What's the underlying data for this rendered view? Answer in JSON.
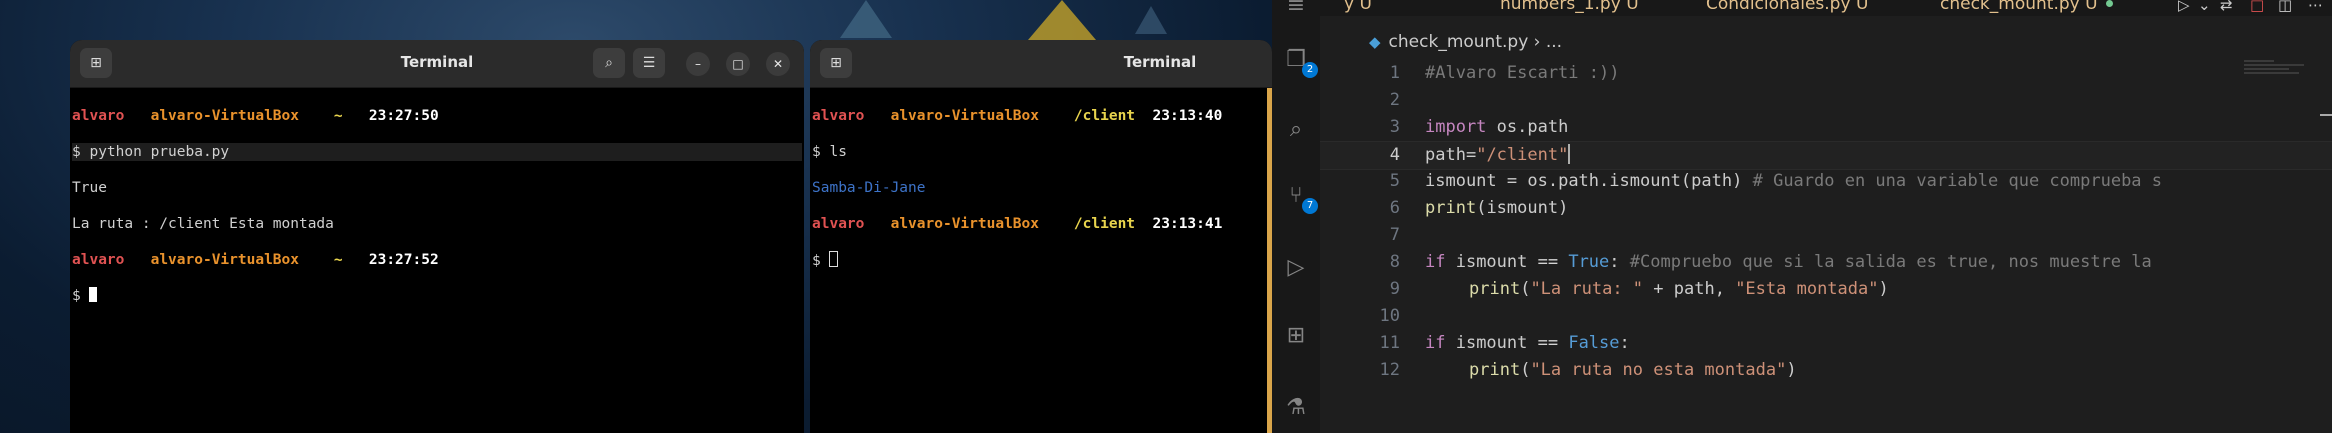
{
  "terminal_left": {
    "title": "Terminal",
    "lines": [
      {
        "user": "alvaro",
        "host": "alvaro-VirtualBox",
        "dir": "~",
        "time": "23:27:50"
      },
      {
        "prompt": "$",
        "cmd": " python prueba.py"
      },
      {
        "out": "True"
      },
      {
        "out": "La ruta : /client Esta montada"
      },
      {
        "user": "alvaro",
        "host": "alvaro-VirtualBox",
        "dir": "~",
        "time": "23:27:52"
      },
      {
        "prompt": "$"
      }
    ]
  },
  "terminal_right": {
    "title": "Terminal",
    "lines": [
      {
        "user": "alvaro",
        "host": "alvaro-VirtualBox",
        "dir": "/client",
        "time": "23:13:40"
      },
      {
        "prompt": "$",
        "cmd": " ls"
      },
      {
        "out": "Samba-Di-Jane"
      },
      {
        "user": "alvaro",
        "host": "alvaro-VirtualBox",
        "dir": "/client",
        "time": "23:13:41"
      },
      {
        "prompt": "$"
      }
    ]
  },
  "vscode": {
    "tabs": [
      {
        "name": "y",
        "status": "U"
      },
      {
        "name": "numbers_1.py",
        "status": "U"
      },
      {
        "name": "Condicionales.py",
        "status": "U"
      },
      {
        "name": "check_mount.py",
        "status": "U"
      }
    ],
    "breadcrumb": {
      "file": "check_mount.py",
      "rest": "› ..."
    },
    "activity_badges": {
      "explorer": "2",
      "source_control": "7"
    },
    "current_line": "4",
    "line_numbers": [
      "1",
      "2",
      "3",
      "4",
      "5",
      "6",
      "7",
      "8",
      "9",
      "10",
      "11",
      "12"
    ],
    "code": {
      "l1": "#Alvaro Escarti :))",
      "l3_kw": "import",
      "l3_rest": " os.path",
      "l4_var": "path",
      "l4_eq": "=",
      "l4_str": "\"/client\"",
      "l5_var": "ismount",
      "l5_eq": " = ",
      "l5_mod": "os.path.",
      "l5_fn": "ismount",
      "l5_paren": "(",
      "l5_arg": "path",
      "l5_paren2": ")",
      "l5_comment": " # Guardo en una variable que comprueba s",
      "l6_fn": "print",
      "l6_paren": "(",
      "l6_arg": "ismount",
      "l6_paren2": ")",
      "l8_kw": "if",
      "l8_var": " ismount ",
      "l8_op": "==",
      "l8_lit": " True",
      "l8_colon": ":",
      "l8_comment": " #Compruebo que si la salida es true, nos muestre la",
      "l9_fn": "print",
      "l9_paren": "(",
      "l9_str1": "\"La ruta: \"",
      "l9_plus": " + ",
      "l9_var": "path",
      "l9_comma": ", ",
      "l9_str2": "\"Esta montada\"",
      "l9_paren2": ")",
      "l11_kw": "if",
      "l11_var": " ismount ",
      "l11_op": "==",
      "l11_lit": " False",
      "l11_colon": ":",
      "l12_fn": "print",
      "l12_paren": "(",
      "l12_str": "\"La ruta no esta montada\"",
      "l12_paren2": ")"
    }
  }
}
